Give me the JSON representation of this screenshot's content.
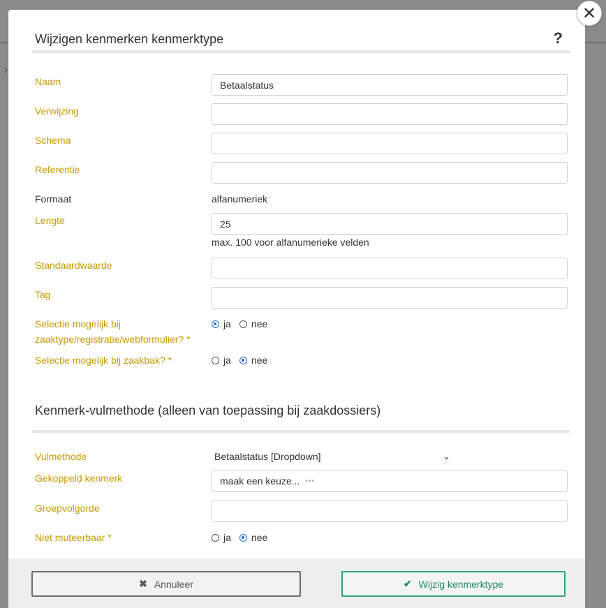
{
  "modal": {
    "title": "Wijzigen kenmerken kenmerktype",
    "help_icon": "?",
    "close_icon": "✕"
  },
  "fields": {
    "naam": {
      "label": "Naam",
      "value": "Betaalstatus"
    },
    "verwijzing": {
      "label": "Verwijzing",
      "value": ""
    },
    "schema": {
      "label": "Schema",
      "value": ""
    },
    "referentie": {
      "label": "Referentie",
      "value": ""
    },
    "formaat": {
      "label": "Formaat",
      "value": "alfanumeriek"
    },
    "lengte": {
      "label": "Lengte",
      "value": "25",
      "hint": "max. 100 voor alfanumerieke velden"
    },
    "standaardwaarde": {
      "label": "Standaardwaarde",
      "value": ""
    },
    "tag": {
      "label": "Tag",
      "value": ""
    },
    "selectie_zaaktype": {
      "label_line1": "Selectie mogelijk bij",
      "label_line2": "zaaktype/registratie/webformulier? *",
      "yes": "ja",
      "no": "nee",
      "selected": "ja"
    },
    "selectie_zaakbak": {
      "label": "Selectie mogelijk bij zaakbak? *",
      "yes": "ja",
      "no": "nee",
      "selected": "nee"
    }
  },
  "vulmethode_section": {
    "title": "Kenmerk-vulmethode (alleen van toepassing bij zaakdossiers)",
    "vulmethode": {
      "label": "Vulmethode",
      "selected": "Betaalstatus [Dropdown]",
      "chevron": "⌄"
    },
    "gekoppeld_kenmerk": {
      "label": "Gekoppeld kenmerk",
      "placeholder": "maak een keuze...",
      "dots": "•••"
    },
    "groepvolgorde": {
      "label": "Groepvolgorde",
      "value": ""
    },
    "niet_muteerbaar": {
      "label": "Niet muteerbaar *",
      "yes": "ja",
      "no": "nee",
      "selected": "nee"
    }
  },
  "footer": {
    "cancel_label": "Annuleer",
    "cancel_icon": "✖",
    "submit_label": "Wijzig kenmerktype",
    "submit_icon": "✔"
  },
  "colors": {
    "label": "#c79a00",
    "radio_checked": "#1b6fc8",
    "submit": "#2aa378"
  }
}
